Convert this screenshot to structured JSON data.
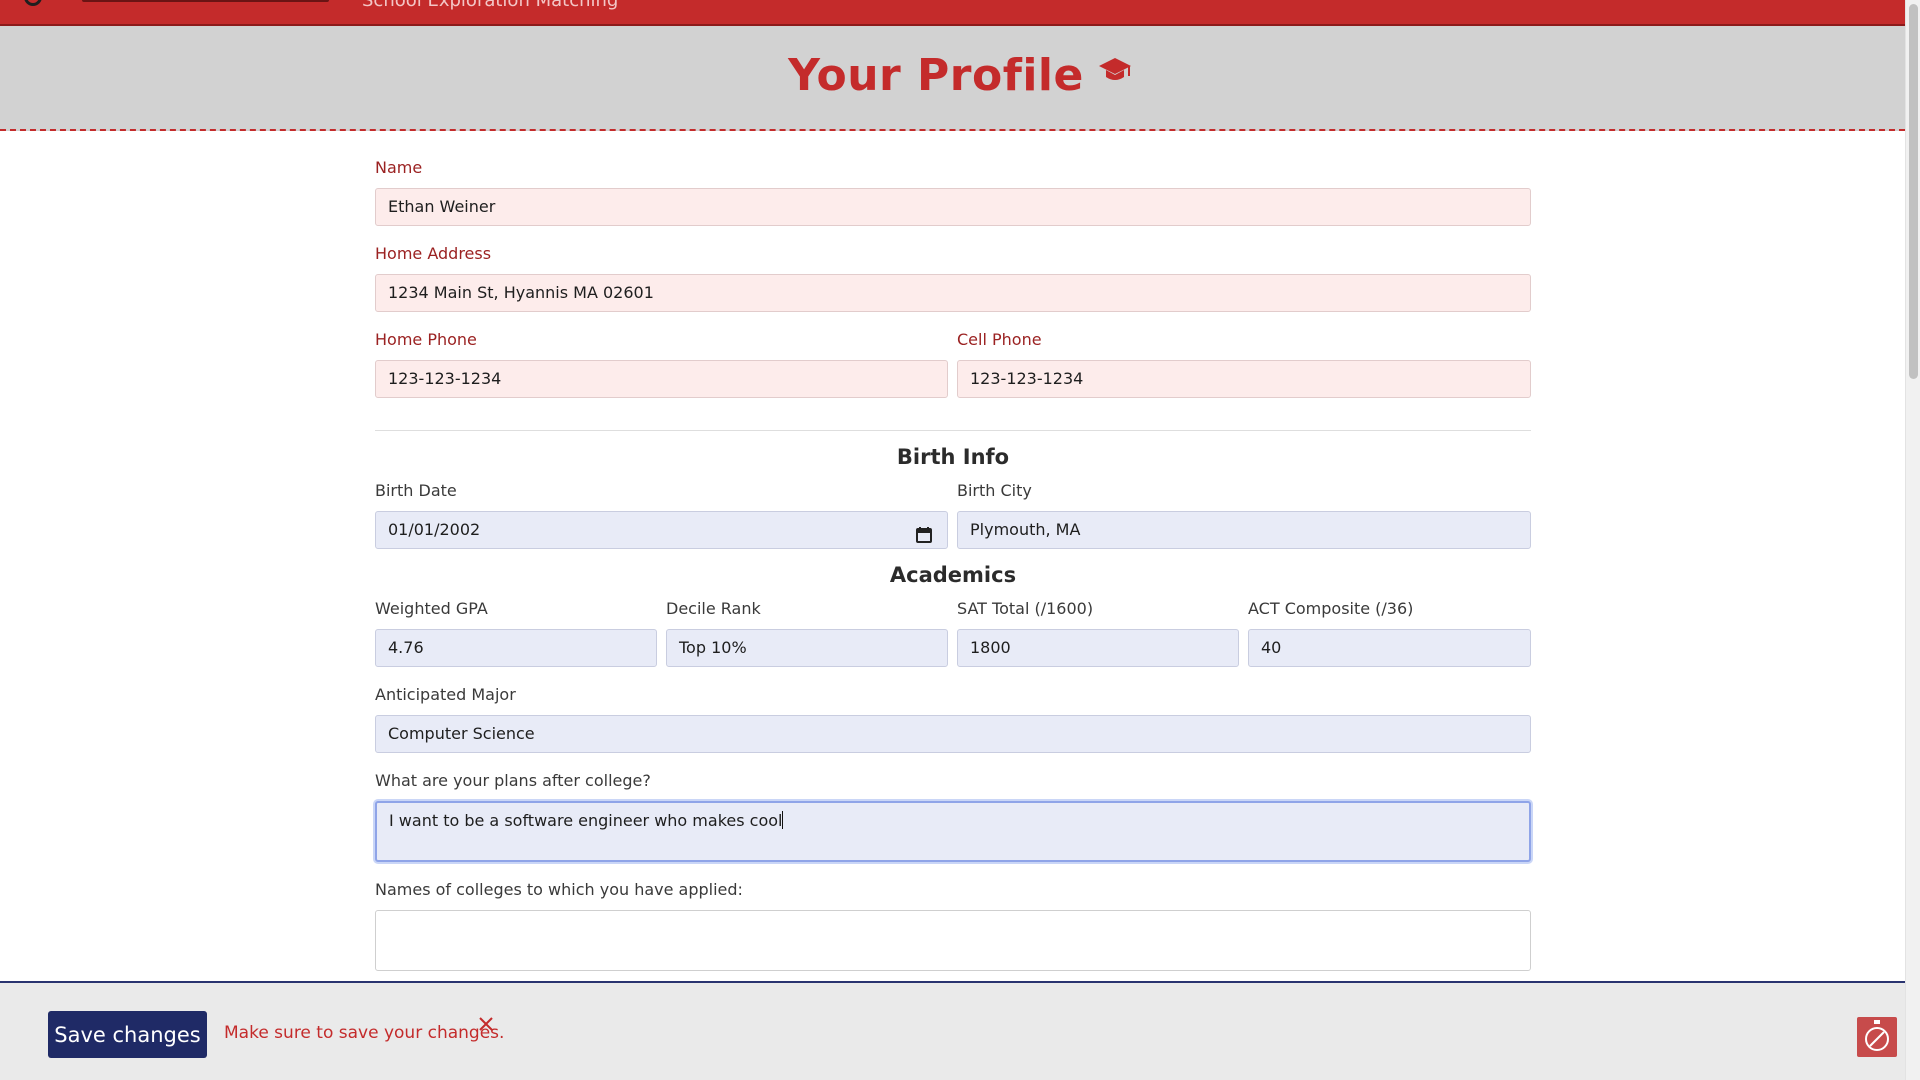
{
  "topbar": {
    "nav_text": "School Exploration  Matching"
  },
  "page": {
    "title": "Your Profile"
  },
  "contact": {
    "name": {
      "label": "Name",
      "value": "Ethan Weiner"
    },
    "home_address": {
      "label": "Home Address",
      "value": "1234 Main St, Hyannis MA 02601"
    },
    "home_phone": {
      "label": "Home Phone",
      "value": "123-123-1234"
    },
    "cell_phone": {
      "label": "Cell Phone",
      "value": "123-123-1234"
    }
  },
  "birth_info": {
    "title": "Birth Info",
    "birth_date": {
      "label": "Birth Date",
      "value": "01/01/2002"
    },
    "birth_city": {
      "label": "Birth City",
      "value": "Plymouth, MA"
    }
  },
  "academics": {
    "title": "Academics",
    "weighted_gpa": {
      "label": "Weighted GPA",
      "value": "4.76"
    },
    "decile_rank": {
      "label": "Decile Rank",
      "value": "Top 10%"
    },
    "sat_total": {
      "label": "SAT Total (/1600)",
      "value": "1800"
    },
    "act_composite": {
      "label": "ACT Composite (/36)",
      "value": "40"
    },
    "anticipated_major": {
      "label": "Anticipated Major",
      "value": "Computer Science"
    },
    "plans_after_college": {
      "label": "What are your plans after college?",
      "value": "I want to be a software engineer who makes cool"
    },
    "colleges_applied": {
      "label": "Names of colleges to which you have applied:",
      "value": ""
    }
  },
  "footer": {
    "save_label": "Save changes",
    "message": "Make sure to save your changes."
  },
  "colors": {
    "brand_red": "#c42b2b",
    "navy": "#1f2a66",
    "pink_field": "#fdeceb",
    "blue_field": "#e8ebf7"
  },
  "icons": [
    "graduation-cap-icon",
    "calendar-icon",
    "close-icon",
    "widget-badge-icon"
  ]
}
